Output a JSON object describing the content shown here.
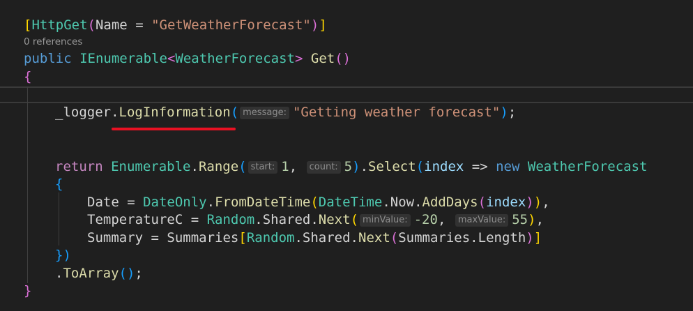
{
  "codelens": {
    "references": "0 references"
  },
  "tokens": {
    "http_get": "HttpGet",
    "name_param": "Name",
    "route_name": "\"GetWeatherForecast\"",
    "kw_public": "public",
    "ienumerable": "IEnumerable",
    "weather_forecast": "WeatherForecast",
    "get_method": "Get",
    "logger": "_logger",
    "log_information": "LogInformation",
    "log_message": "\"Getting weather forecast\"",
    "kw_return": "return",
    "enumerable": "Enumerable",
    "range": "Range",
    "one": "1",
    "five": "5",
    "select": "Select",
    "index": "index",
    "kw_new": "new",
    "date": "Date",
    "dateonly": "DateOnly",
    "from_datetime": "FromDateTime",
    "datetime": "DateTime",
    "now": "Now",
    "add_days": "AddDays",
    "temperature_c": "TemperatureC",
    "random": "Random",
    "shared": "Shared",
    "next": "Next",
    "min_temp": "-20",
    "max_temp": "55",
    "summary": "Summary",
    "summaries": "Summaries",
    "length": "Length",
    "to_array": "ToArray"
  },
  "inlay_hints": {
    "message": "message:",
    "start": "start:",
    "count": "count:",
    "min_value": "minValue:",
    "max_value": "maxValue:"
  },
  "colors": {
    "background": "#1f1f1f",
    "keyword": "#569cd6",
    "control_keyword": "#c586c0",
    "type": "#4ec9b0",
    "method": "#dcdcaa",
    "string": "#ce9178",
    "number": "#b5cea8",
    "variable": "#9cdcfe",
    "error_squiggle": "#e81123"
  },
  "icons": {
    "error": "error-squiggle-underline"
  }
}
